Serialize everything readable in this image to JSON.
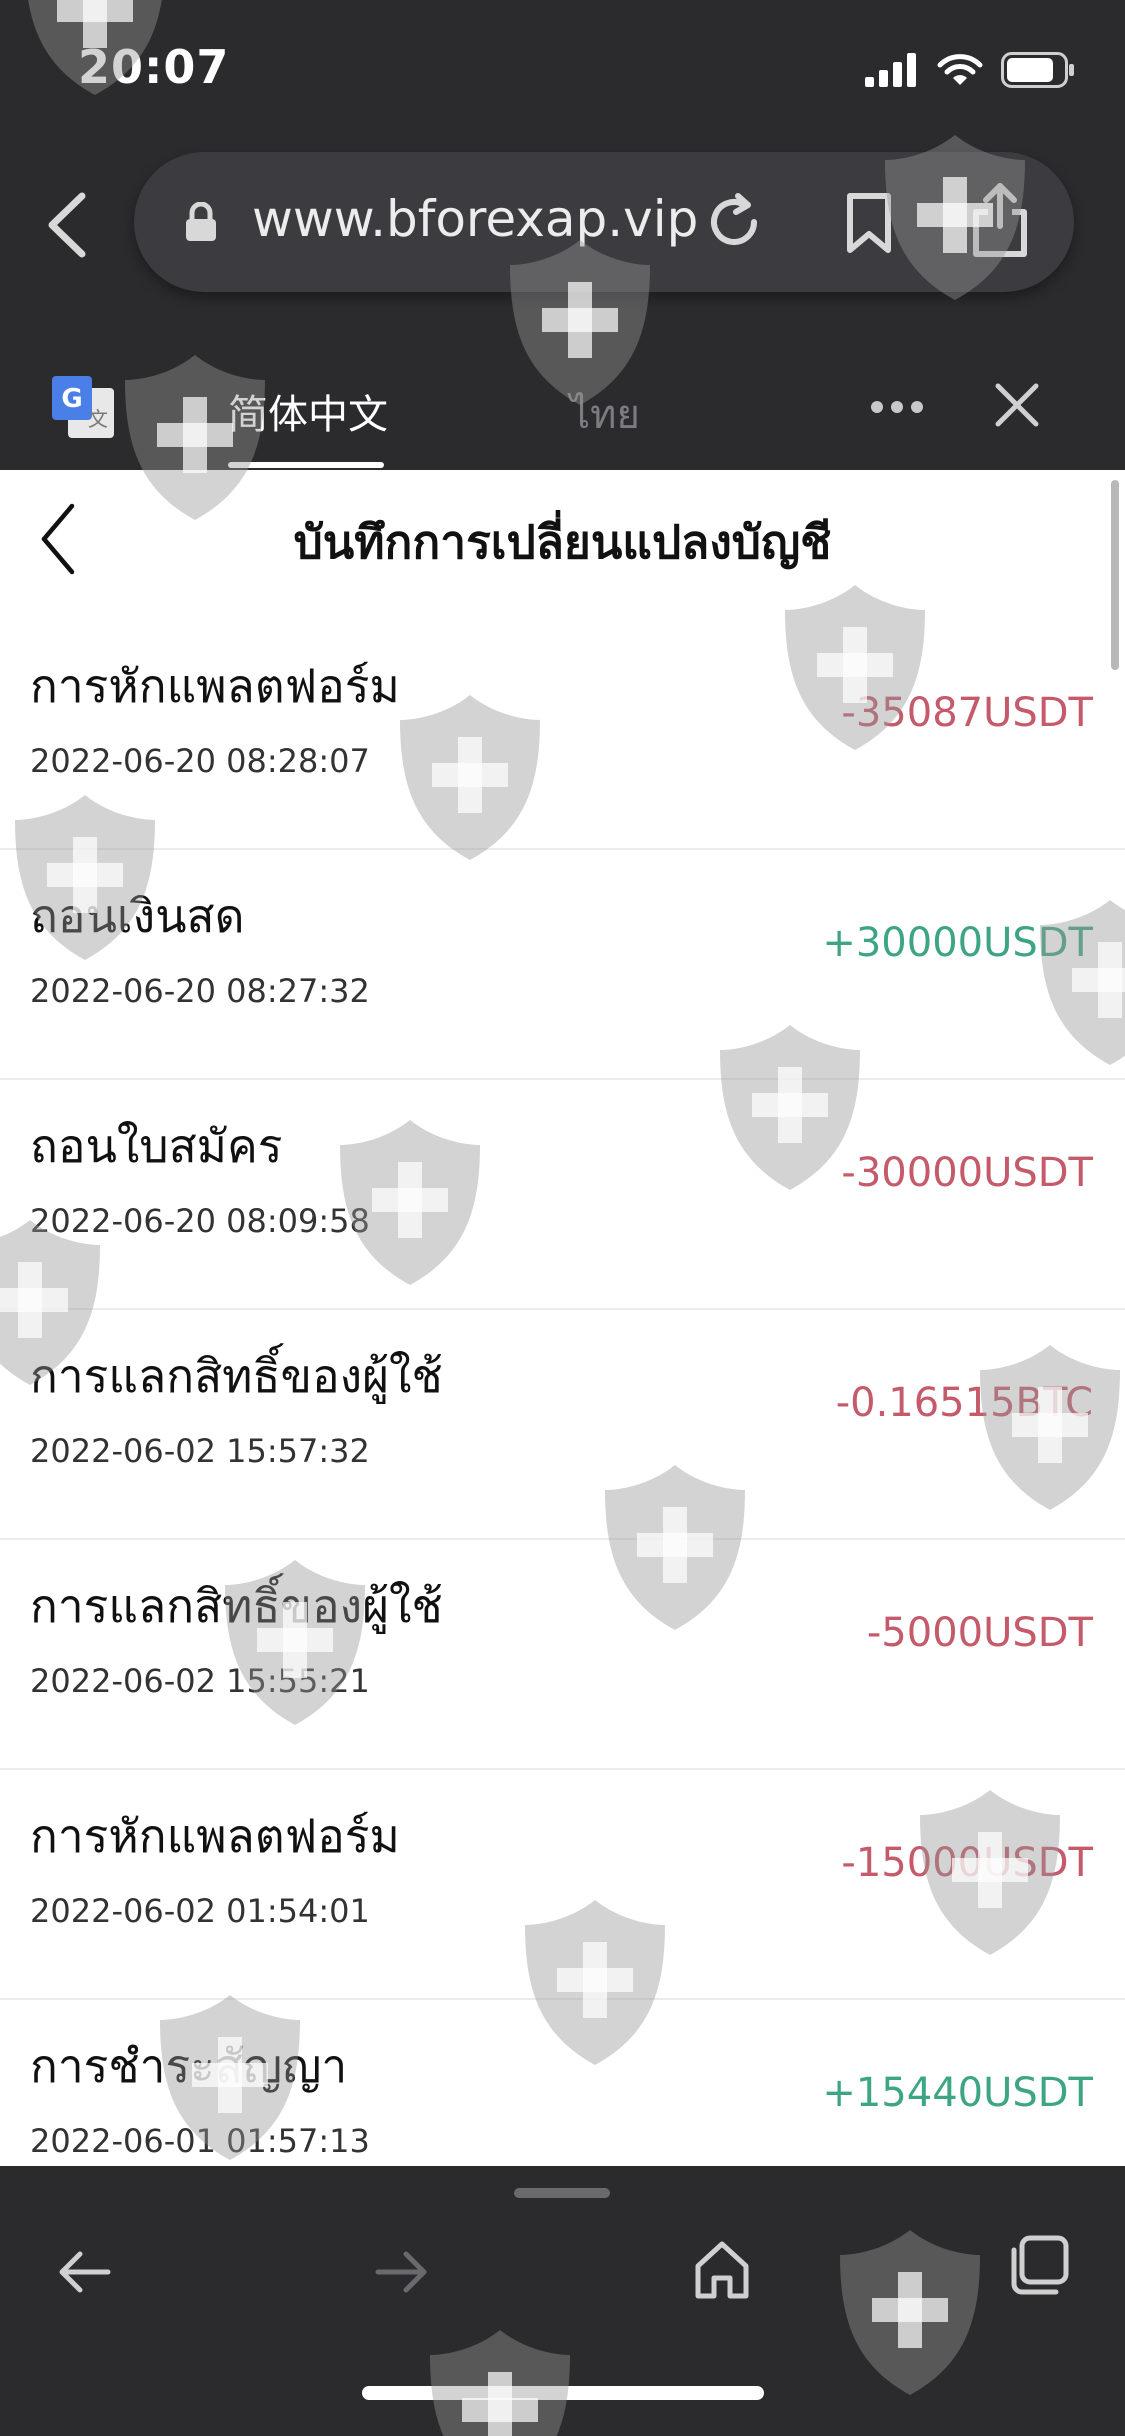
{
  "status_bar": {
    "time": "20:07"
  },
  "browser": {
    "url": "www.bforexap.vip",
    "icons": [
      "lock-icon",
      "reload-icon",
      "bookmark-icon",
      "share-icon"
    ]
  },
  "translate_bar": {
    "tabs": [
      {
        "label": "简体中文",
        "active": true
      },
      {
        "label": "ไทย",
        "active": false
      }
    ]
  },
  "page": {
    "title": "บันทึกการเปลี่ยนแปลงบัญชี",
    "records": [
      {
        "title": "การหักแพลตฟอร์ม",
        "date": "2022-06-20 08:28:07",
        "amount": "-35087USDT",
        "kind": "neg"
      },
      {
        "title": "ถอนเงินสด",
        "date": "2022-06-20 08:27:32",
        "amount": "+30000USDT",
        "kind": "pos"
      },
      {
        "title": "ถอนใบสมัคร",
        "date": "2022-06-20 08:09:58",
        "amount": "-30000USDT",
        "kind": "neg"
      },
      {
        "title": "การแลกสิทธิ์ของผู้ใช้",
        "date": "2022-06-02 15:57:32",
        "amount": "-0.16515BTC",
        "kind": "neg"
      },
      {
        "title": "การแลกสิทธิ์ของผู้ใช้",
        "date": "2022-06-02 15:55:21",
        "amount": "-5000USDT",
        "kind": "neg"
      },
      {
        "title": "การหักแพลตฟอร์ม",
        "date": "2022-06-02 01:54:01",
        "amount": "-15000USDT",
        "kind": "neg"
      },
      {
        "title": "การชำระสัญญา",
        "date": "2022-06-01 01:57:13",
        "amount": "+15440USDT",
        "kind": "pos"
      }
    ]
  },
  "colors": {
    "negative": "#c45a6a",
    "positive": "#3ea584",
    "chrome": "#2b2b2e"
  }
}
